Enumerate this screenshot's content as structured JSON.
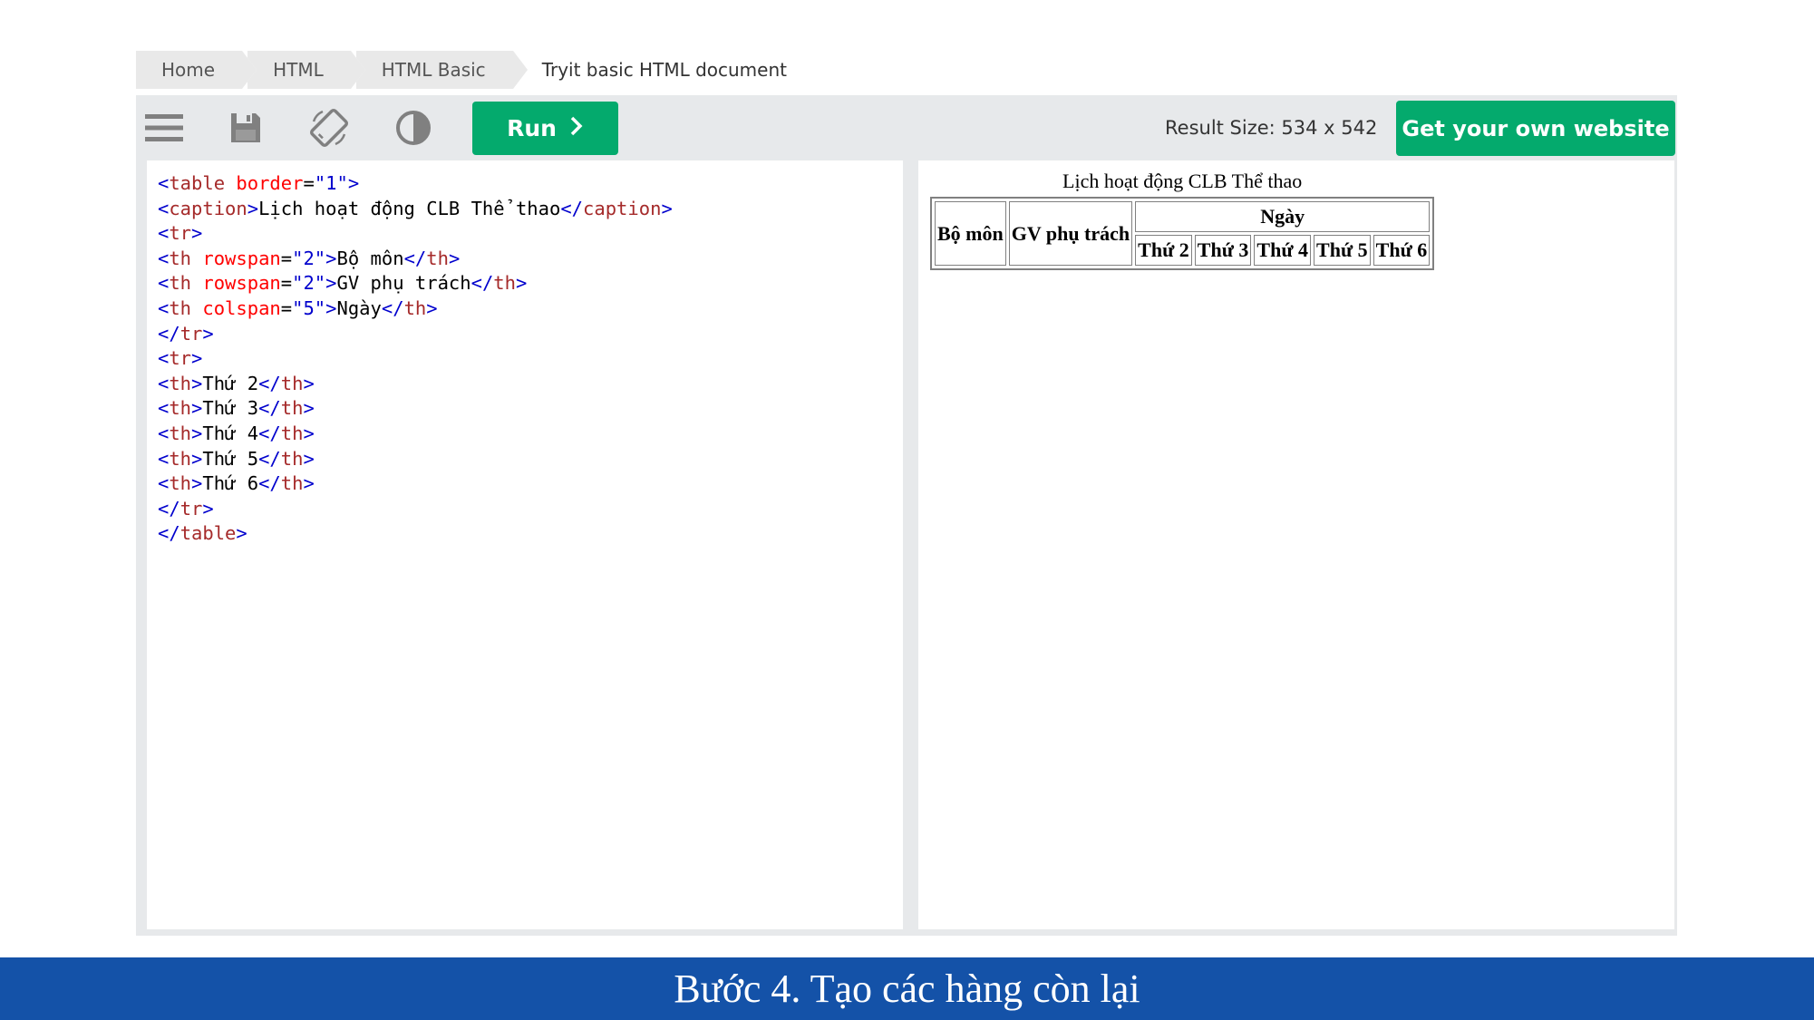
{
  "breadcrumb": {
    "items": [
      "Home",
      "HTML",
      "HTML Basic"
    ],
    "current": "Tryit basic HTML document"
  },
  "toolbar": {
    "icons": [
      "menu-icon",
      "save-icon",
      "rotate-icon",
      "contrast-icon"
    ],
    "run_label": "Run",
    "result_size": "Result Size: 534 x 542",
    "get_website_label": "Get your own website"
  },
  "code_lines": [
    "<table border=\"1\">",
    "<caption>Lịch hoạt động CLB Thể thao</caption>",
    "<tr>",
    "<th rowspan=\"2\">Bộ môn</th>",
    "<th rowspan=\"2\">GV phụ trách</th>",
    "<th colspan=\"5\">Ngày</th>",
    "</tr>",
    "<tr>",
    "<th>Thứ 2</th>",
    "<th>Thứ 3</th>",
    "<th>Thứ 4</th>",
    "<th>Thứ 5</th>",
    "<th>Thứ 6</th>",
    "</tr>",
    "</table>"
  ],
  "result": {
    "caption": "Lịch hoạt động CLB Thể thao",
    "header_row1": {
      "subject": "Bộ môn",
      "teacher": "GV phụ trách",
      "day": "Ngày"
    },
    "days": [
      "Thứ 2",
      "Thứ 3",
      "Thứ 4",
      "Thứ 5",
      "Thứ 6"
    ]
  },
  "footer": {
    "title": "Bước 4. Tạo các hàng còn lại"
  },
  "colors": {
    "accent_green": "#04aa6d",
    "footer_blue": "#1452a8",
    "toolbar_gray": "#e7e9eb"
  }
}
